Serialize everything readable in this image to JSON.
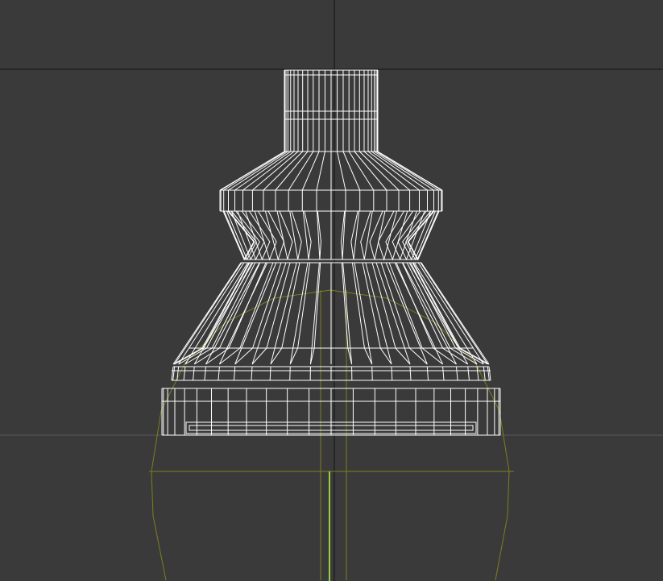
{
  "viewport": {
    "view": "front",
    "display_mode": "wireframe",
    "background_color": "#3a3a3a",
    "crosshair_color": "#111111",
    "grid_color": "#5a5a5a",
    "mesh_color": "#ffffff",
    "gizmo_color": "#8a8a22",
    "axis_color": "#9bd13a"
  },
  "model": {
    "type": "lamp-shade-mesh",
    "segments": 24
  }
}
